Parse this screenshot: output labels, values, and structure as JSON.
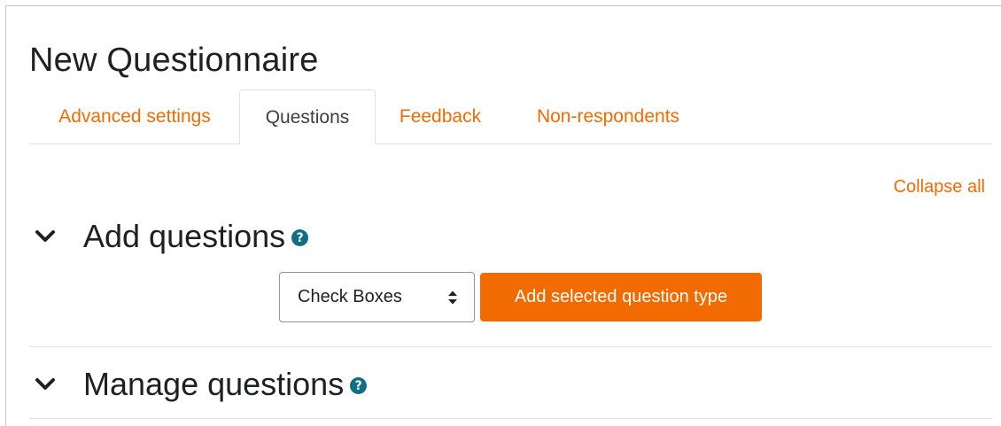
{
  "page": {
    "title": "New Questionnaire"
  },
  "tabs": [
    {
      "label": "Advanced settings",
      "active": false
    },
    {
      "label": "Questions",
      "active": true
    },
    {
      "label": "Feedback",
      "active": false
    },
    {
      "label": "Non-respondents",
      "active": false
    }
  ],
  "collapse_all_label": "Collapse all",
  "sections": {
    "add_questions": {
      "title": "Add questions",
      "expanded": true,
      "icon": "chevron-down-icon",
      "help_icon": "question-circle-icon"
    },
    "manage_questions": {
      "title": "Manage questions",
      "expanded": true,
      "icon": "chevron-down-icon",
      "help_icon": "question-circle-icon"
    }
  },
  "question_type_select": {
    "selected": "Check Boxes",
    "icon": "sort-caret-icon"
  },
  "add_button_label": "Add selected question type",
  "colors": {
    "accent": "#f26b00",
    "help_icon": "#0f6f85",
    "text": "#1d2125",
    "border": "#dee2e6"
  }
}
